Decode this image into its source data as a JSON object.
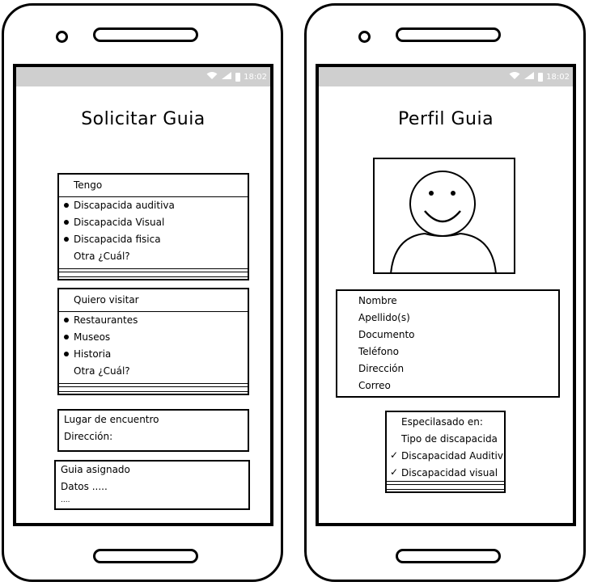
{
  "status": {
    "time": "18:02"
  },
  "left": {
    "title": "Solicitar Guia",
    "tengo": {
      "header": "Tengo",
      "options": [
        "Discapacida auditiva",
        "Discapacida Visual",
        "Discapacida fisica"
      ],
      "other": "Otra ¿Cuál?"
    },
    "visitar": {
      "header": "Quiero visitar",
      "options": [
        "Restaurantes",
        "Museos",
        "Historia"
      ],
      "other": "Otra ¿Cuál?"
    },
    "encuentro": {
      "line1": "Lugar de encuentro",
      "line2": "Dirección:"
    },
    "guia": {
      "line1": "Guia asignado",
      "line2": "Datos .....",
      "line3": "...."
    }
  },
  "right": {
    "title": "Perfil Guia",
    "fields": [
      "Nombre",
      "Apellido(s)",
      "Documento",
      "Teléfono",
      "Dirección",
      "Correo"
    ],
    "specialty": {
      "header": "Especilasado en:",
      "subheader": "Tipo de discapacida",
      "items": [
        "Discapacidad Auditiv",
        "Discapacidad visual"
      ]
    }
  },
  "icons": {
    "wifi": "wifi-icon",
    "signal": "signal-icon",
    "battery": "battery-icon",
    "check": "checkmark-icon",
    "avatar": "avatar-face-icon"
  }
}
